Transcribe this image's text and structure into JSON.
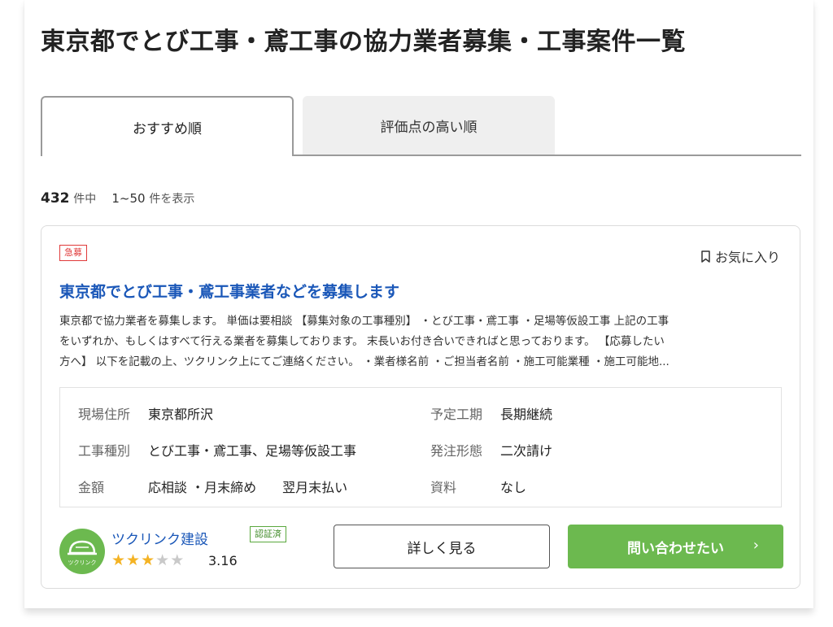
{
  "page": {
    "title": "東京都でとび工事・鳶工事の協力業者募集・工事案件一覧"
  },
  "tabs": [
    {
      "label": "おすすめ順",
      "active": true
    },
    {
      "label": "評価点の高い順",
      "active": false
    }
  ],
  "results": {
    "total": "432",
    "total_suffix": "件中",
    "range": "1~50",
    "range_suffix": "件を表示"
  },
  "card": {
    "badge": "急募",
    "favorite_label": "お気に入り",
    "title": "東京都でとび工事・鳶工事業者などを募集します",
    "description_lines": [
      "東京都で協力業者を募集します。 単価は要相談 【募集対象の工事種別】 ・とび工事・鳶工事 ・足場等仮設工事 上記の工事",
      "をいずれか、もしくはすべて行える業者を募集しております。 末長いお付き合いできればと思っております。 【応募したい",
      "方へ】 以下を記載の上、ツクリンク上にてご連絡ください。 ・業者様名前 ・ご担当者名前 ・施工可能業種 ・施工可能地..."
    ],
    "details": {
      "location_label": "現場住所",
      "location_value": "東京都所沢",
      "period_label": "予定工期",
      "period_value": "長期継続",
      "work_type_label": "工事種別",
      "work_type_value": "とび工事・鳶工事、足場等仮設工事",
      "order_type_label": "発注形態",
      "order_type_value": "二次請け",
      "amount_label": "金額",
      "amount_value": "応相談 ・月末締め　　翌月末払い",
      "docs_label": "資料",
      "docs_value": "なし"
    },
    "company": {
      "name": "ツクリンク建設",
      "logo_text": "ツクリンク",
      "verified_label": "認証済",
      "rating": "3.16",
      "stars_filled": 3,
      "stars_total": 5
    },
    "buttons": {
      "detail": "詳しく見る",
      "contact": "問い合わせたい",
      "contact_chevron": "›"
    }
  },
  "colors": {
    "accent_green": "#6cb94f",
    "link_blue": "#1a57b8",
    "urgent_red": "#e03a3a",
    "star_gold": "#f4b324"
  }
}
